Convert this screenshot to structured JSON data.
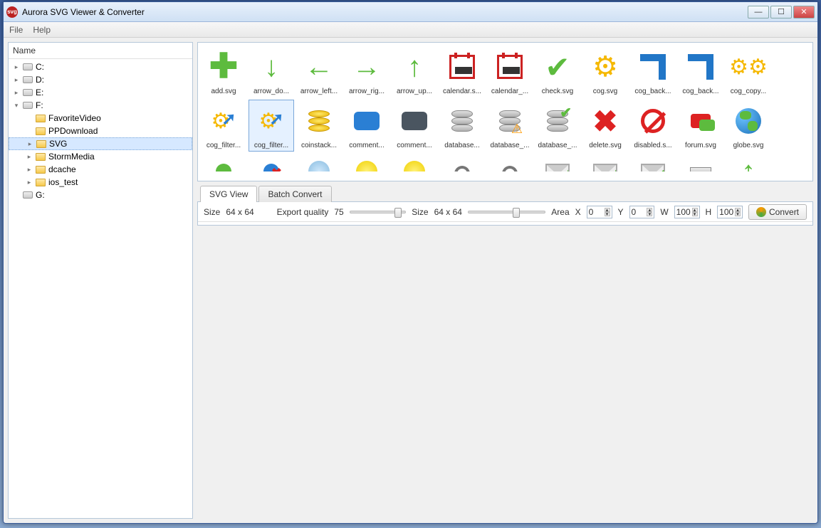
{
  "title": "Aurora SVG Viewer & Converter",
  "menu": {
    "file": "File",
    "help": "Help"
  },
  "sidebar": {
    "header": "Name",
    "nodes": [
      {
        "label": "C:",
        "icon": "drive",
        "depth": 0,
        "expander": "▸"
      },
      {
        "label": "D:",
        "icon": "drive",
        "depth": 0,
        "expander": "▸"
      },
      {
        "label": "E:",
        "icon": "drive",
        "depth": 0,
        "expander": "▸"
      },
      {
        "label": "F:",
        "icon": "drive",
        "depth": 0,
        "expander": "▾"
      },
      {
        "label": "FavoriteVideo",
        "icon": "folder",
        "depth": 1,
        "expander": ""
      },
      {
        "label": "PPDownload",
        "icon": "folder",
        "depth": 1,
        "expander": ""
      },
      {
        "label": "SVG",
        "icon": "folder",
        "depth": 1,
        "expander": "▸",
        "selected": true
      },
      {
        "label": "StormMedia",
        "icon": "folder",
        "depth": 1,
        "expander": "▸"
      },
      {
        "label": "dcache",
        "icon": "folder",
        "depth": 1,
        "expander": "▸"
      },
      {
        "label": "ios_test",
        "icon": "folder",
        "depth": 1,
        "expander": "▸"
      },
      {
        "label": "G:",
        "icon": "drive",
        "depth": 0,
        "expander": ""
      }
    ]
  },
  "thumbs": {
    "row1": [
      {
        "name": "add.svg",
        "kind": "plus"
      },
      {
        "name": "arrow_do...",
        "kind": "arrow-down"
      },
      {
        "name": "arrow_left...",
        "kind": "arrow-left"
      },
      {
        "name": "arrow_rig...",
        "kind": "arrow-right"
      },
      {
        "name": "arrow_up...",
        "kind": "arrow-up"
      },
      {
        "name": "calendar.s...",
        "kind": "calendar"
      },
      {
        "name": "calendar_...",
        "kind": "calendar"
      },
      {
        "name": "check.svg",
        "kind": "check"
      },
      {
        "name": "cog.svg",
        "kind": "cog"
      },
      {
        "name": "cog_back...",
        "kind": "corner"
      },
      {
        "name": "cog_back...",
        "kind": "corner"
      },
      {
        "name": "cog_copy...",
        "kind": "cogs"
      }
    ],
    "row2": [
      {
        "name": "cog_filter...",
        "kind": "cog-arrow"
      },
      {
        "name": "cog_filter...",
        "kind": "cog-arrow",
        "selected": true
      },
      {
        "name": "coinstack...",
        "kind": "coins"
      },
      {
        "name": "comment...",
        "kind": "bubble-blue"
      },
      {
        "name": "comment...",
        "kind": "bubble-dark"
      },
      {
        "name": "database...",
        "kind": "db"
      },
      {
        "name": "database_...",
        "kind": "db-warn"
      },
      {
        "name": "database_...",
        "kind": "db-ok"
      },
      {
        "name": "delete.svg",
        "kind": "x"
      },
      {
        "name": "disabled.s...",
        "kind": "disabled"
      },
      {
        "name": "forum.svg",
        "kind": "forum"
      },
      {
        "name": "globe.svg",
        "kind": "globe"
      }
    ],
    "row3": [
      {
        "kind": "people"
      },
      {
        "kind": "person-del"
      },
      {
        "kind": "face"
      },
      {
        "kind": "dot-yel"
      },
      {
        "kind": "dot-yel"
      },
      {
        "kind": "lock"
      },
      {
        "kind": "lock"
      },
      {
        "kind": "env-down"
      },
      {
        "kind": "env-down-g"
      },
      {
        "kind": "env-up"
      },
      {
        "kind": "hdd"
      },
      {
        "kind": "arrow-up-g"
      }
    ]
  },
  "tabs": {
    "svgview": "SVG View",
    "batch": "Batch Convert"
  },
  "toolbar": {
    "size_label": "Size",
    "size_value": "64 x 64",
    "export_label": "Export  quality",
    "export_value": "75",
    "size2_label": "Size",
    "size2_value": "64 x 64",
    "area_label": "Area",
    "x_label": "X",
    "x_val": "0",
    "y_label": "Y",
    "y_val": "0",
    "w_label": "W",
    "w_val": "100",
    "h_label": "H",
    "h_val": "100",
    "convert": "Convert"
  }
}
